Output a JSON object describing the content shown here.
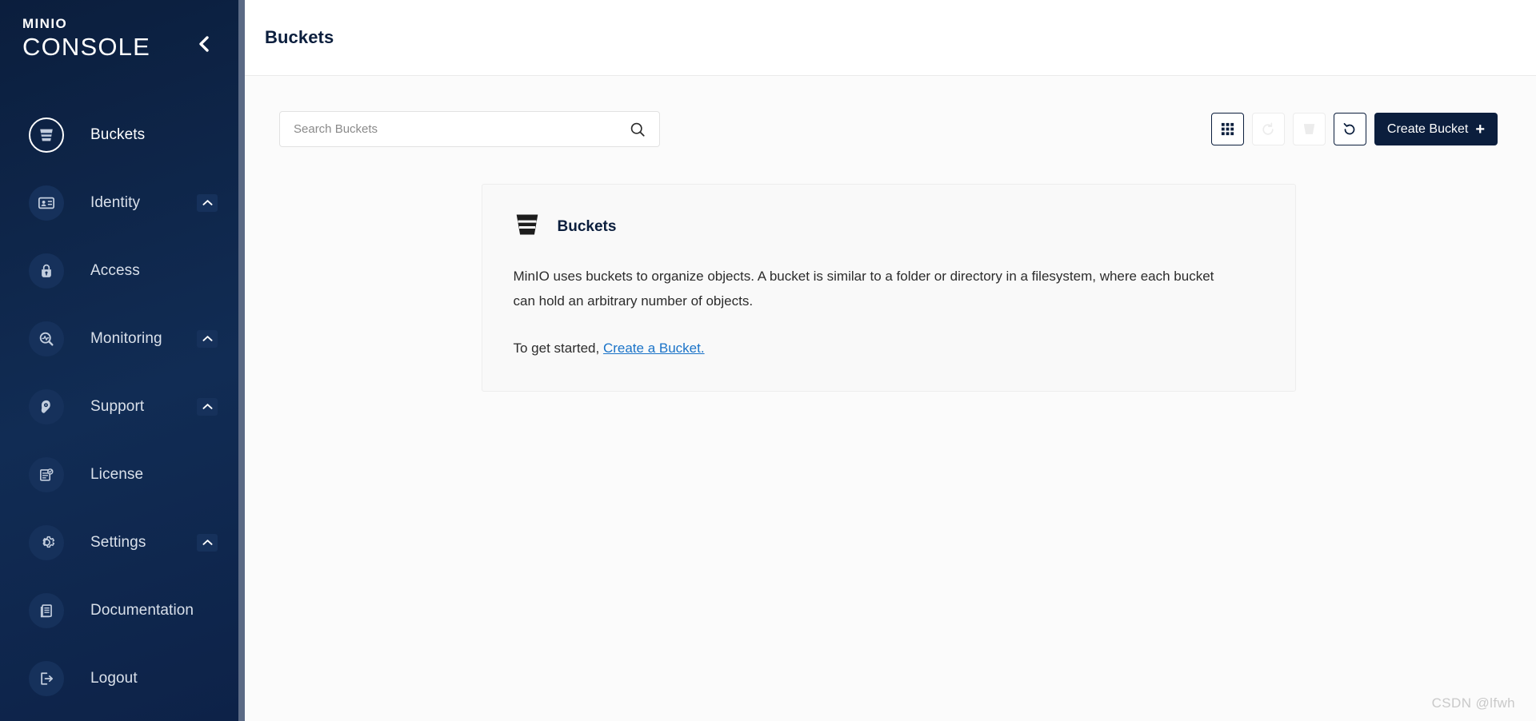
{
  "brand": {
    "line1": "MINIO",
    "line2": "CONSOLE",
    "collapse_icon": "chevron-left-icon"
  },
  "sidebar": {
    "items": [
      {
        "label": "Buckets",
        "icon": "bucket-icon",
        "active": true,
        "expandable": false
      },
      {
        "label": "Identity",
        "icon": "id-card-icon",
        "active": false,
        "expandable": true
      },
      {
        "label": "Access",
        "icon": "lock-icon",
        "active": false,
        "expandable": false
      },
      {
        "label": "Monitoring",
        "icon": "magnifier-pulse-icon",
        "active": false,
        "expandable": true
      },
      {
        "label": "Support",
        "icon": "headset-icon",
        "active": false,
        "expandable": true
      },
      {
        "label": "License",
        "icon": "certificate-icon",
        "active": false,
        "expandable": false
      },
      {
        "label": "Settings",
        "icon": "gear-icon",
        "active": false,
        "expandable": true
      },
      {
        "label": "Documentation",
        "icon": "book-icon",
        "active": false,
        "expandable": false
      },
      {
        "label": "Logout",
        "icon": "logout-icon",
        "active": false,
        "expandable": false
      }
    ]
  },
  "header": {
    "title": "Buckets"
  },
  "search": {
    "placeholder": "Search Buckets",
    "value": "",
    "icon": "search-icon"
  },
  "toolbar": {
    "buttons": [
      {
        "name": "grid-view-button",
        "icon": "grid-icon",
        "disabled": false
      },
      {
        "name": "lifecycle-button",
        "icon": "sync-refresh-icon",
        "disabled": true
      },
      {
        "name": "delete-bucket-button",
        "icon": "bucket-icon",
        "disabled": true
      },
      {
        "name": "refresh-button",
        "icon": "refresh-icon",
        "disabled": false
      }
    ],
    "create_label": "Create Bucket",
    "create_plus": "+",
    "accent_color": "#0b1e3d"
  },
  "info_card": {
    "icon": "bucket-icon",
    "title": "Buckets",
    "body": "MinIO uses buckets to organize objects. A bucket is similar to a folder or directory in a filesystem, where each bucket can hold an arbitrary number of objects.",
    "started_prefix": "To get started, ",
    "link_label": "Create a Bucket.",
    "link_color": "#1a73c8"
  },
  "watermark": {
    "text": "CSDN @lfwh"
  }
}
